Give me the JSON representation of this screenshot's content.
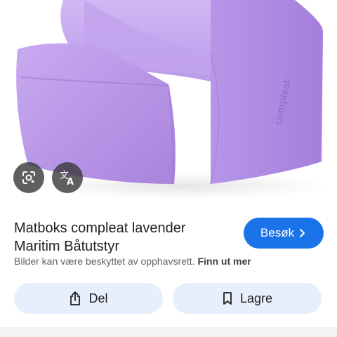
{
  "product_image": {
    "alt": "compleat",
    "brand_mark": "compleat",
    "color": "#b594e6"
  },
  "overlay_buttons": {
    "lens_icon": "google-lens-icon",
    "translate_icon": "translate-icon"
  },
  "result": {
    "title": "Matboks compleat lavender Maritim Båtutstyr",
    "visit_label": "Besøk",
    "copyright_text": "Bilder kan være beskyttet av opphavsrett.",
    "learn_more_label": "Finn ut mer"
  },
  "actions": {
    "share_label": "Del",
    "save_label": "Lagre"
  },
  "colors": {
    "accent": "#1a73e8",
    "action_bg": "#e8effc"
  }
}
